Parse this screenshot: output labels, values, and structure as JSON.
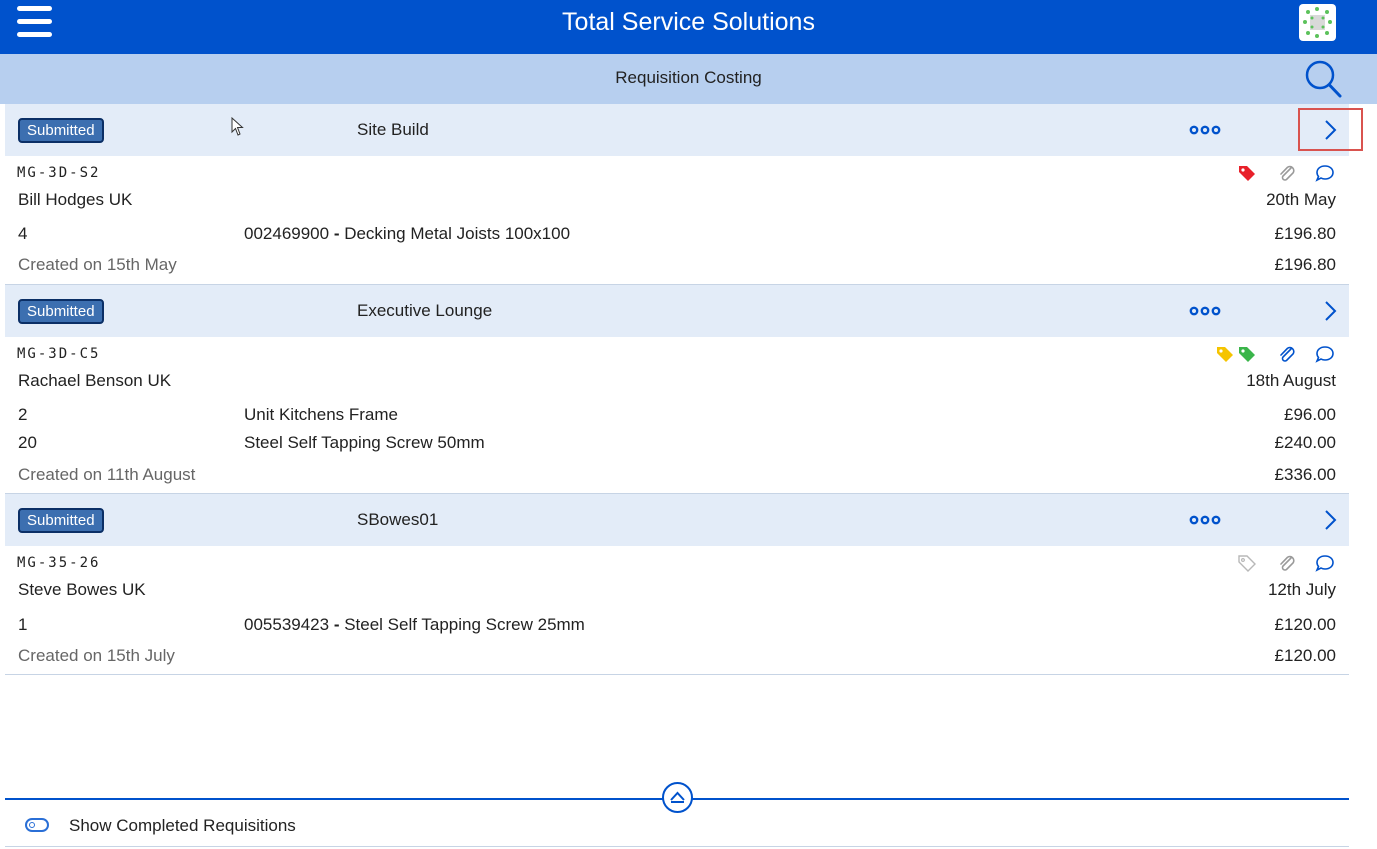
{
  "app": {
    "title": "Total Service Solutions"
  },
  "toolbar": {
    "title": "Requisition Costing",
    "search_icon": "search-icon",
    "menu_icon": "hamburger-menu-icon"
  },
  "colors": {
    "primary": "#0052cc",
    "subheader": "#b7cfef",
    "row_header": "#e3ecf8",
    "badge": "#3c6fb0",
    "tag_red": "#e8202a",
    "tag_yellow": "#f5c400",
    "tag_green": "#3ab54a",
    "tag_grey": "#b8b8b8"
  },
  "requisitions": [
    {
      "status": "Submitted",
      "name": "Site Build",
      "code": "MG-3D-S2",
      "requester": "Bill Hodges UK",
      "date": "20th May",
      "tags": [
        "red"
      ],
      "lines": [
        {
          "qty": "4",
          "code": "002469900",
          "sep": " - ",
          "desc": "Decking Metal Joists 100x100",
          "price": "£196.80"
        }
      ],
      "created": "Created on 15th May",
      "total": "£196.80"
    },
    {
      "status": "Submitted",
      "name": "Executive Lounge",
      "code": "MG-3D-C5",
      "requester": "Rachael Benson UK",
      "date": "18th August",
      "tags": [
        "yellow",
        "green"
      ],
      "lines": [
        {
          "qty": "2",
          "code": "",
          "sep": "",
          "desc": "Unit Kitchens Frame",
          "price": "£96.00"
        },
        {
          "qty": "20",
          "code": "",
          "sep": "",
          "desc": "Steel Self Tapping Screw 50mm",
          "price": "£240.00"
        }
      ],
      "created": "Created on 11th August",
      "total": "£336.00"
    },
    {
      "status": "Submitted",
      "name": "SBowes01",
      "code": "MG-35-26",
      "requester": "Steve Bowes UK",
      "date": "12th July",
      "tags": [
        "grey"
      ],
      "lines": [
        {
          "qty": "1",
          "code": "005539423",
          "sep": " - ",
          "desc": "Steel Self Tapping Screw 25mm",
          "price": "£120.00"
        }
      ],
      "created": "Created on 15th July",
      "total": "£120.00"
    }
  ],
  "footer": {
    "toggle_label": "Show Completed Requisitions"
  }
}
